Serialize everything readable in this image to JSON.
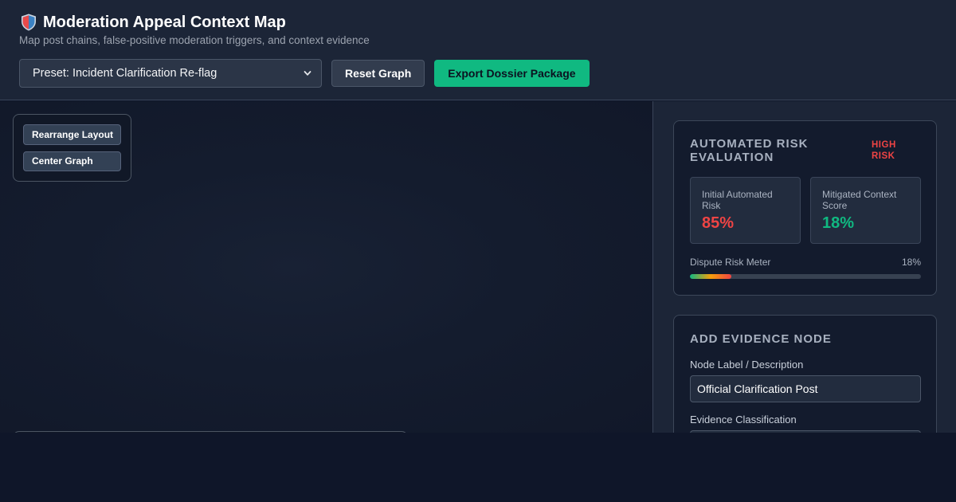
{
  "header": {
    "title": "Moderation Appeal Context Map",
    "title_icon": "shield-icon",
    "subtitle": "Map post chains, false-positive moderation triggers, and context evidence"
  },
  "toolbar": {
    "preset_value": "Preset: Incident Clarification Re-flag",
    "reset_label": "Reset Graph",
    "export_label": "Export Dossier Package",
    "export_color": "#10b981"
  },
  "graph_tools": {
    "rearrange_label": "Rearrange Layout",
    "center_label": "Center Graph"
  },
  "risk": {
    "title": "AUTOMATED RISK EVALUATION",
    "badge": "HIGH RISK",
    "badge_color": "#ef4444",
    "initial_label": "Initial Automated Risk",
    "initial_value": "85%",
    "initial_color": "#ef4444",
    "mitigated_label": "Mitigated Context Score",
    "mitigated_value": "18%",
    "mitigated_color": "#10b981",
    "meter_label": "Dispute Risk Meter",
    "meter_value": "18%",
    "meter_fraction": 0.18
  },
  "evidence": {
    "title": "ADD EVIDENCE NODE",
    "label_field_label": "Node Label / Description",
    "label_field_value": "Official Clarification Post",
    "classification_label": "Evidence Classification"
  }
}
